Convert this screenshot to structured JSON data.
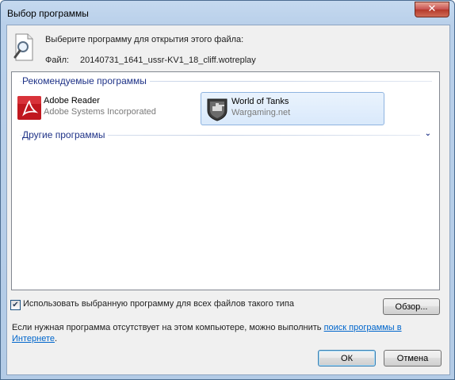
{
  "window": {
    "title": "Выбор программы",
    "close_label": "✕"
  },
  "header": {
    "prompt": "Выберите программу для открытия этого файла:",
    "file_label": "Файл:",
    "file_name": "20140731_1641_ussr-KV1_18_cliff.wotreplay"
  },
  "groups": {
    "recommended": {
      "title": "Рекомендуемые программы"
    },
    "other": {
      "title": "Другие программы"
    }
  },
  "programs": [
    {
      "name": "Adobe Reader",
      "company": "Adobe Systems Incorporated",
      "icon": "adobe-reader-icon",
      "selected": false
    },
    {
      "name": "World of Tanks",
      "company": "Wargaming.net",
      "icon": "world-of-tanks-icon",
      "selected": true
    }
  ],
  "options": {
    "always_use_label": "Использовать выбранную программу для всех файлов такого типа",
    "always_use_checked": true,
    "browse_label": "Обзор..."
  },
  "info": {
    "text": "Если нужная программа отсутствует на этом компьютере, можно выполнить ",
    "link_text": "поиск программы в Интернете",
    "text_end": "."
  },
  "buttons": {
    "ok": "ОК",
    "cancel": "Отмена"
  },
  "colors": {
    "group_title": "#1e3287",
    "link": "#0066cc",
    "close_button": "#c75050"
  }
}
